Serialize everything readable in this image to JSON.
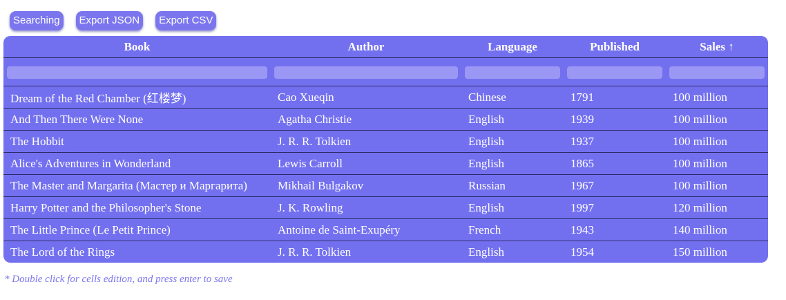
{
  "toolbar": {
    "searching_label": "Searching",
    "export_json_label": "Export JSON",
    "export_csv_label": "Export CSV"
  },
  "table": {
    "columns": [
      {
        "label": "Book"
      },
      {
        "label": "Author"
      },
      {
        "label": "Language"
      },
      {
        "label": "Published"
      },
      {
        "label": "Sales ↑"
      }
    ],
    "filters": [
      "",
      "",
      "",
      "",
      ""
    ],
    "rows": [
      [
        "Dream of the Red Chamber (红楼梦)",
        "Cao Xueqin",
        "Chinese",
        "1791",
        "100 million"
      ],
      [
        "And Then There Were None",
        "Agatha Christie",
        "English",
        "1939",
        "100 million"
      ],
      [
        "The Hobbit",
        "J. R. R. Tolkien",
        "English",
        "1937",
        "100 million"
      ],
      [
        "Alice's Adventures in Wonderland",
        "Lewis Carroll",
        "English",
        "1865",
        "100 million"
      ],
      [
        "The Master and Margarita (Мастер и Маргарита)",
        "Mikhail Bulgakov",
        "Russian",
        "1967",
        "100 million"
      ],
      [
        "Harry Potter and the Philosopher's Stone",
        "J. K. Rowling",
        "English",
        "1997",
        "120 million"
      ],
      [
        "The Little Prince (Le Petit Prince)",
        "Antoine de Saint-Exupéry",
        "French",
        "1943",
        "140 million"
      ],
      [
        "The Lord of the Rings",
        "J. R. R. Tolkien",
        "English",
        "1954",
        "150 million"
      ]
    ]
  },
  "footnote": "* Double click for cells edition, and press enter to save",
  "colors": {
    "accent": "#7370f0",
    "button": "#7b76ee",
    "filter_field": "#9b97f4",
    "row_divider": "#2a2a66"
  }
}
